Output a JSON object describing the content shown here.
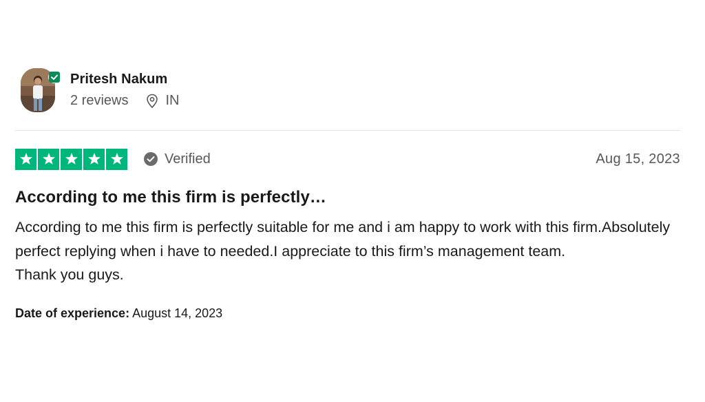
{
  "reviewer": {
    "name": "Pritesh Nakum",
    "reviews_count": "2 reviews",
    "country": "IN",
    "avatar_icon": "avatar-photo",
    "verified_badge_icon": "check-badge-icon"
  },
  "review": {
    "rating": 5,
    "rating_max": 5,
    "star_color": "#00b67a",
    "verified_label": "Verified",
    "date": "Aug 15, 2023",
    "title": "According to me this firm is perfectly…",
    "body_lines": [
      "According to me this firm is perfectly suitable for me and i am happy to work with this firm.Absolutely perfect replying when i have to needed.I appreciate to this firm’s management team.",
      "Thank you guys."
    ],
    "experience_label": "Date of experience:",
    "experience_date": "August 14, 2023"
  }
}
